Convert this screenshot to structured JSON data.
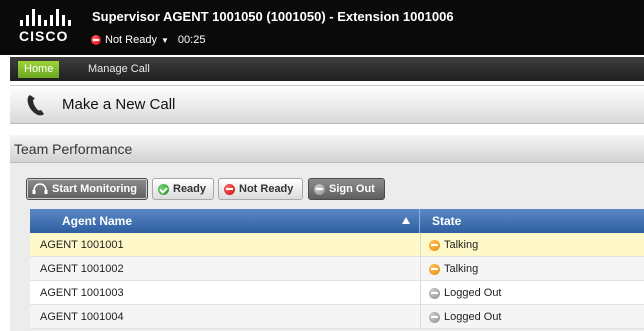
{
  "header": {
    "logo_text": "CISCO",
    "title": "Supervisor AGENT 1001050 (1001050) - Extension 1001006",
    "status": "Not Ready",
    "timer": "00:25"
  },
  "nav": {
    "home_label": "Home",
    "manage_call_label": "Manage Call"
  },
  "call_panel": {
    "title": "Make a New Call"
  },
  "team": {
    "title": "Team Performance",
    "buttons": {
      "start_monitoring": "Start Monitoring",
      "ready": "Ready",
      "not_ready": "Not Ready",
      "sign_out": "Sign Out"
    },
    "table": {
      "columns": [
        "Agent Name",
        "State"
      ],
      "rows": [
        {
          "agent": "AGENT 1001001",
          "state": "Talking",
          "state_icon": "talking-icon"
        },
        {
          "agent": "AGENT 1001002",
          "state": "Talking",
          "state_icon": "talking-icon"
        },
        {
          "agent": "AGENT 1001003",
          "state": "Logged Out",
          "state_icon": "logged-out-icon"
        },
        {
          "agent": "AGENT 1001004",
          "state": "Logged Out",
          "state_icon": "logged-out-icon"
        }
      ]
    }
  },
  "colors": {
    "header_bg": "#0a0a0a",
    "home_tab": "#8cc63f",
    "table_header": "#3d6fb0",
    "selected_row": "#fff8c9",
    "ready_green": "#2a9a2a",
    "not_ready_red": "#d40000",
    "talking_orange": "#f0a020"
  }
}
